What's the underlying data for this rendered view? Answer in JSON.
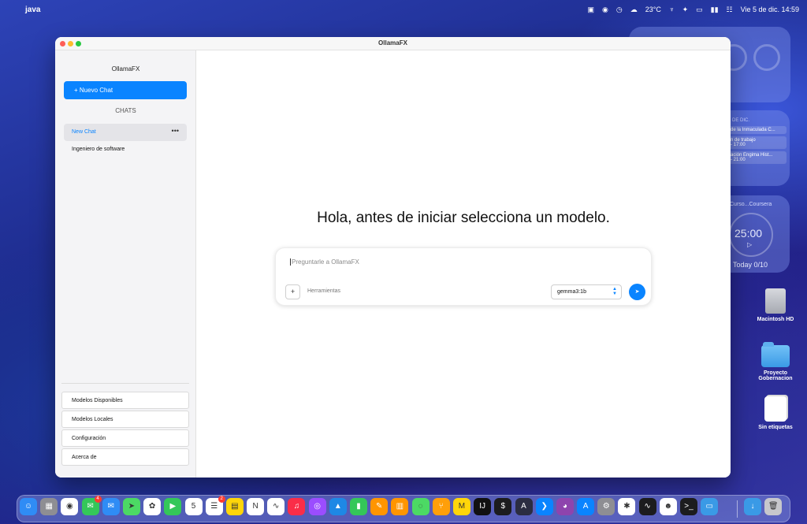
{
  "menubar": {
    "app_name": "java",
    "weather": "23°C",
    "datetime": "Vie 5 de dic.  14:59"
  },
  "widgets": {
    "calendar_header": "8 DE DIC.",
    "events": [
      {
        "title": "de la Inmaculada C...",
        "time": ""
      },
      {
        "title": "n de trabajo",
        "time": "- 17:00"
      },
      {
        "title": "ación Engima Hist...",
        "time": "- 21:00"
      }
    ],
    "timer_title": "Curso...Coursera",
    "timer_time": "25:00",
    "timer_today": "Today 0/10"
  },
  "desktop": {
    "items": [
      {
        "label": "Macintosh HD",
        "icon": "disk-icon"
      },
      {
        "label": "Proyecto Gobernacion",
        "icon": "folder-icon"
      },
      {
        "label": "Sin etiquetas",
        "icon": "stack-icon"
      }
    ]
  },
  "window": {
    "title": "OllamaFX"
  },
  "sidebar": {
    "title": "OllamaFX",
    "new_chat": "+ Nuevo Chat",
    "chats_header": "CHATS",
    "chats": [
      {
        "label": "New Chat",
        "active": true
      },
      {
        "label": "Ingeniero de software",
        "active": false
      }
    ],
    "more_glyph": "•••",
    "bottom_buttons": [
      "Modelos Disponibles",
      "Modelos Locales",
      "Configuración",
      "Acerca de"
    ]
  },
  "main": {
    "greeting": "Hola, antes de iniciar selecciona un modelo.",
    "prompt_placeholder": "Preguntarle a OllamaFX",
    "plus_label": "+",
    "tools_label": "Herramientas",
    "model_selected": "gemma3:1b",
    "send_glyph": "➤"
  },
  "dock": {
    "apps": [
      {
        "name": "finder-icon",
        "color": "#2f8cf5",
        "glyph": "☺"
      },
      {
        "name": "launchpad-icon",
        "color": "#8e8e93",
        "glyph": "▦"
      },
      {
        "name": "chrome-icon",
        "color": "#ffffff",
        "glyph": "◉"
      },
      {
        "name": "messages-icon",
        "color": "#34c759",
        "glyph": "✉",
        "badge": "4"
      },
      {
        "name": "mail-icon",
        "color": "#2f8cf5",
        "glyph": "✉"
      },
      {
        "name": "maps-icon",
        "color": "#4cd964",
        "glyph": "➤"
      },
      {
        "name": "photos-icon",
        "color": "#ffffff",
        "glyph": "✿"
      },
      {
        "name": "facetime-icon",
        "color": "#34c759",
        "glyph": "▶"
      },
      {
        "name": "calendar-icon",
        "color": "#ffffff",
        "glyph": "5"
      },
      {
        "name": "reminders-icon",
        "color": "#ffffff",
        "glyph": "☰",
        "badge": "2"
      },
      {
        "name": "notes-icon",
        "color": "#ffd60a",
        "glyph": "▤"
      },
      {
        "name": "notion-icon",
        "color": "#ffffff",
        "glyph": "N"
      },
      {
        "name": "freeform-icon",
        "color": "#ffffff",
        "glyph": "∿"
      },
      {
        "name": "music-icon",
        "color": "#fa2d48",
        "glyph": "♫"
      },
      {
        "name": "podcasts-icon",
        "color": "#9b4dff",
        "glyph": "◎"
      },
      {
        "name": "keynote-icon",
        "color": "#1e88e5",
        "glyph": "▲"
      },
      {
        "name": "numbers-icon",
        "color": "#34c759",
        "glyph": "▮"
      },
      {
        "name": "pages-icon",
        "color": "#ff9500",
        "glyph": "✎"
      },
      {
        "name": "books-icon",
        "color": "#ff9500",
        "glyph": "▥"
      },
      {
        "name": "app-icon-green",
        "color": "#4cd964",
        "glyph": "◌"
      },
      {
        "name": "sourcetree-icon",
        "color": "#ff9f0a",
        "glyph": "⑂"
      },
      {
        "name": "miro-icon",
        "color": "#ffd60a",
        "glyph": "M"
      },
      {
        "name": "intellij-icon",
        "color": "#111111",
        "glyph": "IJ"
      },
      {
        "name": "terminal-icon",
        "color": "#1c1c1e",
        "glyph": "$"
      },
      {
        "name": "arc-icon",
        "color": "#2b2d42",
        "glyph": "A"
      },
      {
        "name": "vscode-icon",
        "color": "#0a84ff",
        "glyph": "❯"
      },
      {
        "name": "github-icon",
        "color": "#8e44ad",
        "glyph": "◕"
      },
      {
        "name": "app-store-icon",
        "color": "#0a84ff",
        "glyph": "A"
      },
      {
        "name": "system-settings-icon",
        "color": "#8e8e93",
        "glyph": "⚙"
      },
      {
        "name": "slack-icon",
        "color": "#ffffff",
        "glyph": "✱"
      },
      {
        "name": "activity-monitor-icon",
        "color": "#1c1c1e",
        "glyph": "∿"
      },
      {
        "name": "ollama-icon",
        "color": "#ffffff",
        "glyph": "☻"
      },
      {
        "name": "terminal-icon-2",
        "color": "#1c1c1e",
        "glyph": ">_"
      },
      {
        "name": "folder-icon",
        "color": "#3a9ae6",
        "glyph": "▭"
      }
    ],
    "right_apps": [
      {
        "name": "downloads-icon",
        "color": "#3a9ae6",
        "glyph": "↓"
      },
      {
        "name": "trash-icon",
        "color": "#c7c7cc",
        "glyph": "🗑"
      }
    ]
  }
}
